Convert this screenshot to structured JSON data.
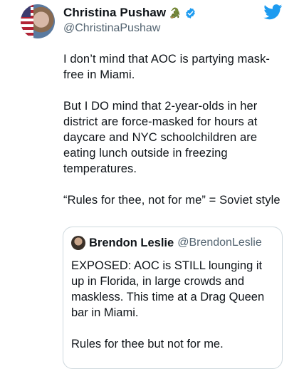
{
  "author": {
    "display_name": "Christina Pushaw",
    "name_emoji": "🐊",
    "handle": "@ChristinaPushaw",
    "verified": true,
    "avatar_icon": "profile-photo"
  },
  "brand": {
    "icon": "twitter-bird-icon",
    "color": "#1d9bf0"
  },
  "tweet": {
    "paragraphs": [
      "I don’t mind that AOC is partying mask-free in Miami.",
      "But I DO mind that 2-year-olds in her district are force-masked for hours at daycare and NYC schoolchildren are eating lunch outside in freezing temperatures.",
      "“Rules for thee, not for me” = Soviet style"
    ]
  },
  "quoted_tweet": {
    "display_name": "Brendon Leslie",
    "handle": "@BrendonLeslie",
    "paragraphs": [
      "EXPOSED: AOC is STILL lounging it up in Florida, in large crowds and maskless. This time at a Drag Queen bar in Miami.",
      "Rules for thee but not for me."
    ]
  },
  "colors": {
    "text": "#0f1419",
    "secondary": "#536471",
    "verified": "#1d9bf0",
    "border": "#cfd9de"
  }
}
